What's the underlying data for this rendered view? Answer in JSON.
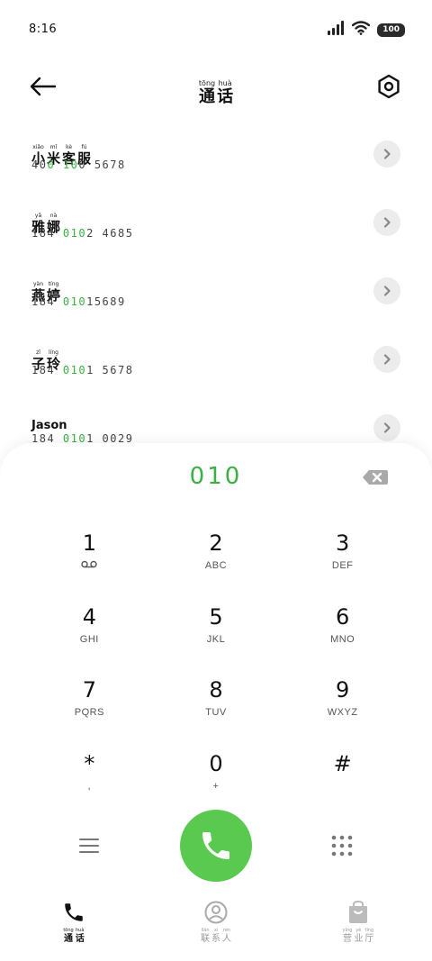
{
  "status_bar": {
    "time": "8:16",
    "battery": "100",
    "icons": [
      "signal-icon",
      "wifi-icon",
      "battery-icon"
    ]
  },
  "header": {
    "title": [
      {
        "pinyin": "tōng",
        "char": "通"
      },
      {
        "pinyin": "huà",
        "char": "话"
      }
    ],
    "icons": [
      "back-arrow-icon",
      "settings-hexagon-icon"
    ]
  },
  "contacts": [
    {
      "name": [
        {
          "pinyin": "xiǎo",
          "char": "小"
        },
        {
          "pinyin": "mǐ",
          "char": "米"
        },
        {
          "pinyin": "kè",
          "char": "客"
        },
        {
          "pinyin": "fú",
          "char": "服"
        }
      ],
      "number_pre": "40",
      "number_hl1": "0",
      "number_mid": " ",
      "number_hl2": "10",
      "number_post": "0 5678"
    },
    {
      "name": [
        {
          "pinyin": "yǎ",
          "char": "雅"
        },
        {
          "pinyin": "nà",
          "char": "娜"
        }
      ],
      "number_pre": "184 ",
      "number_hl": "010",
      "number_post": "2 4685"
    },
    {
      "name": [
        {
          "pinyin": "yàn",
          "char": "燕"
        },
        {
          "pinyin": "tíng",
          "char": "婷"
        }
      ],
      "number_pre": "184 ",
      "number_hl": "010",
      "number_post": "15689"
    },
    {
      "name": [
        {
          "pinyin": "zǐ",
          "char": "子"
        },
        {
          "pinyin": "líng",
          "char": "玲"
        }
      ],
      "number_pre": "184 ",
      "number_hl": "010",
      "number_post": "1 5678"
    },
    {
      "name_text": "Jason",
      "number_pre": "184 ",
      "number_hl": "010",
      "number_post": "1 0029"
    }
  ],
  "dialer": {
    "input": "010",
    "keys": [
      {
        "digit": "1",
        "letters": "voicemail-icon"
      },
      {
        "digit": "2",
        "letters": "ABC"
      },
      {
        "digit": "3",
        "letters": "DEF"
      },
      {
        "digit": "4",
        "letters": "GHI"
      },
      {
        "digit": "5",
        "letters": "JKL"
      },
      {
        "digit": "6",
        "letters": "MNO"
      },
      {
        "digit": "7",
        "letters": "PQRS"
      },
      {
        "digit": "8",
        "letters": "TUV"
      },
      {
        "digit": "9",
        "letters": "WXYZ"
      },
      {
        "digit": "*",
        "letters": ","
      },
      {
        "digit": "0",
        "letters": "+"
      },
      {
        "digit": "#",
        "letters": ""
      }
    ],
    "call_color": "#5ac94f",
    "highlight_color": "#3cb043"
  },
  "bottom_nav": [
    {
      "id": "calls",
      "icon": "phone-icon",
      "label": [
        {
          "pinyin": "tōng",
          "char": "通"
        },
        {
          "pinyin": "huà",
          "char": "话"
        }
      ],
      "active": true
    },
    {
      "id": "contacts",
      "icon": "person-icon",
      "label": [
        {
          "pinyin": "lián",
          "char": "联"
        },
        {
          "pinyin": "xì",
          "char": "系"
        },
        {
          "pinyin": "rén",
          "char": "人"
        }
      ],
      "active": false
    },
    {
      "id": "service",
      "icon": "bag-icon",
      "label": [
        {
          "pinyin": "yíng",
          "char": "营"
        },
        {
          "pinyin": "yè",
          "char": "业"
        },
        {
          "pinyin": "tīng",
          "char": "厅"
        }
      ],
      "active": false
    }
  ]
}
